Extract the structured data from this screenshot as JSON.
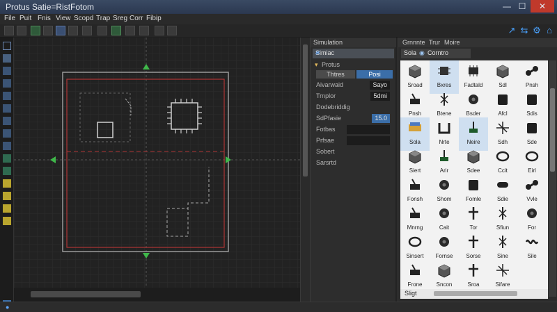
{
  "window": {
    "title": "Protus Satie=RistFotom",
    "minimize": "—",
    "maximize": "☐",
    "close": "✕"
  },
  "menu": [
    "File",
    "Puit",
    "Fnis",
    "View",
    "Scopd",
    "Trap",
    "Sreg",
    "Corr",
    "Fibip"
  ],
  "sim": {
    "header": "Simulation",
    "search_value": "Simiac",
    "section": "Protus",
    "tab_a": "Thtres",
    "tab_b": "Posi",
    "rows": [
      {
        "label": "Aivarwaid",
        "value": "Sayo"
      },
      {
        "label": "Trnplor",
        "value": "5dmi"
      },
      {
        "label": "Dodebriddig",
        "value": ""
      },
      {
        "label": "SdPfasie",
        "value": "15.0"
      },
      {
        "label": "Fotbas",
        "value": ""
      },
      {
        "label": "Prfsae",
        "value": ""
      },
      {
        "label": "Sobert",
        "value": ""
      },
      {
        "label": "Sarsrtd",
        "value": ""
      }
    ]
  },
  "lib": {
    "tabs": [
      "Grnnnte",
      "Trur",
      "Moire"
    ],
    "search_a": "Sola",
    "search_b": "Corntro",
    "footer": "Sligt",
    "items": [
      {
        "label": "Sroad",
        "icon": "cube-icon"
      },
      {
        "label": "Bxres",
        "icon": "chip-icon"
      },
      {
        "label": "Fadtald",
        "icon": "ic-package-icon"
      },
      {
        "label": "Sdl",
        "icon": "cube-icon"
      },
      {
        "label": "Pnsh",
        "icon": "dumbbell-icon"
      },
      {
        "label": "Pnsh",
        "icon": "lever-icon"
      },
      {
        "label": "Btene",
        "icon": "bolt-icon"
      },
      {
        "label": "Bsder",
        "icon": "gear-icon"
      },
      {
        "label": "Afcl",
        "icon": "block-icon"
      },
      {
        "label": "Sdis",
        "icon": "block-icon"
      },
      {
        "label": "Sola",
        "icon": "board-icon"
      },
      {
        "label": "Nrte",
        "icon": "pipe-icon"
      },
      {
        "label": "Neire",
        "icon": "pin-icon"
      },
      {
        "label": "Sdh",
        "icon": "spark-icon"
      },
      {
        "label": "Sde",
        "icon": "block-icon"
      },
      {
        "label": "Siert",
        "icon": "cube-icon"
      },
      {
        "label": "Arir",
        "icon": "pin-icon"
      },
      {
        "label": "Sdee",
        "icon": "cube-icon"
      },
      {
        "label": "Ccit",
        "icon": "ring-icon"
      },
      {
        "label": "Eirl",
        "icon": "ring-icon"
      },
      {
        "label": "Fonsh",
        "icon": "lever-icon"
      },
      {
        "label": "Shom",
        "icon": "gear-icon"
      },
      {
        "label": "Fomle",
        "icon": "block-icon"
      },
      {
        "label": "Sdie",
        "icon": "cylinder-icon"
      },
      {
        "label": "Vvle",
        "icon": "dumbbell-icon"
      },
      {
        "label": "Mnrng",
        "icon": "lever-icon"
      },
      {
        "label": "Cait",
        "icon": "gear-icon"
      },
      {
        "label": "Tor",
        "icon": "cross-icon"
      },
      {
        "label": "Sfiun",
        "icon": "bolt-icon"
      },
      {
        "label": "For",
        "icon": "gear-icon"
      },
      {
        "label": "Sinsert",
        "icon": "ring-icon"
      },
      {
        "label": "Fornse",
        "icon": "gear-icon"
      },
      {
        "label": "Sorse",
        "icon": "cross-icon"
      },
      {
        "label": "Sine",
        "icon": "bolt-icon"
      },
      {
        "label": "Sile",
        "icon": "spring-icon"
      },
      {
        "label": "Frone",
        "icon": "lever-icon"
      },
      {
        "label": "Sncon",
        "icon": "cube-icon"
      },
      {
        "label": "Sroa",
        "icon": "cross-icon"
      },
      {
        "label": "Sifare",
        "icon": "spark-icon"
      },
      {
        "label": "",
        "icon": "blank-icon"
      }
    ]
  },
  "colors": {
    "accent": "#3b6ea8",
    "grid": "#3a3a3a",
    "board": "#c83c3c",
    "marker": "#3fb84a"
  }
}
